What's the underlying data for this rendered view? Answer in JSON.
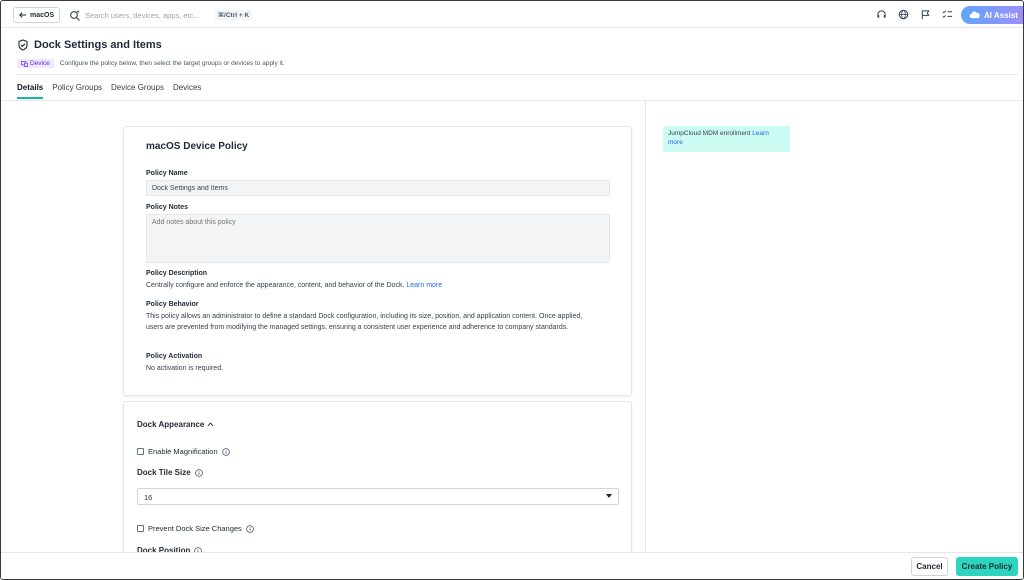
{
  "topbar": {
    "back_label": "macOS",
    "search_placeholder": "Search users, devices, apps, etc...",
    "shortcut": "⌘/Ctrl + K",
    "ai_label": "AI Assist"
  },
  "header": {
    "title": "Dock Settings and Items",
    "badge": "Device",
    "subtitle": "Configure the policy below, then select the target groups or devices to apply it."
  },
  "tabs": [
    "Details",
    "Policy Groups",
    "Device Groups",
    "Devices"
  ],
  "policy_card": {
    "title": "macOS Device Policy",
    "name_label": "Policy Name",
    "name_value": "Dock Settings and Items",
    "notes_label": "Policy Notes",
    "notes_placeholder": "Add notes about this policy",
    "description_label": "Policy Description",
    "description_text": "Centrally configure and enforce the appearance, content, and behavior of the Dock.",
    "description_link": "Learn more",
    "behavior_label": "Policy Behavior",
    "behavior_text": "This policy allows an administrator to define a standard Dock configuration, including its size, position, and application content. Once applied, users are prevented from modifying the managed settings, ensuring a consistent user experience and adherence to company standards.",
    "activation_label": "Policy Activation",
    "activation_text": "No activation is required."
  },
  "appearance_card": {
    "section_title": "Dock Appearance",
    "magnification_label": "Enable Magnification",
    "tile_size_label": "Dock Tile Size",
    "tile_size_value": "16",
    "prevent_size_label": "Prevent Dock Size Changes",
    "position_label": "Dock Position"
  },
  "notice": {
    "text": "JumpCloud MDM enrollment",
    "link": "Learn more"
  },
  "footer": {
    "cancel_label": "Cancel",
    "create_label": "Create Policy"
  },
  "colors": {
    "accent": "#2dd4bf",
    "tab_underline": "#14b8a6",
    "link": "#2563eb",
    "notice_bg": "#ccfbf1",
    "badge_bg": "#ede9fe"
  }
}
